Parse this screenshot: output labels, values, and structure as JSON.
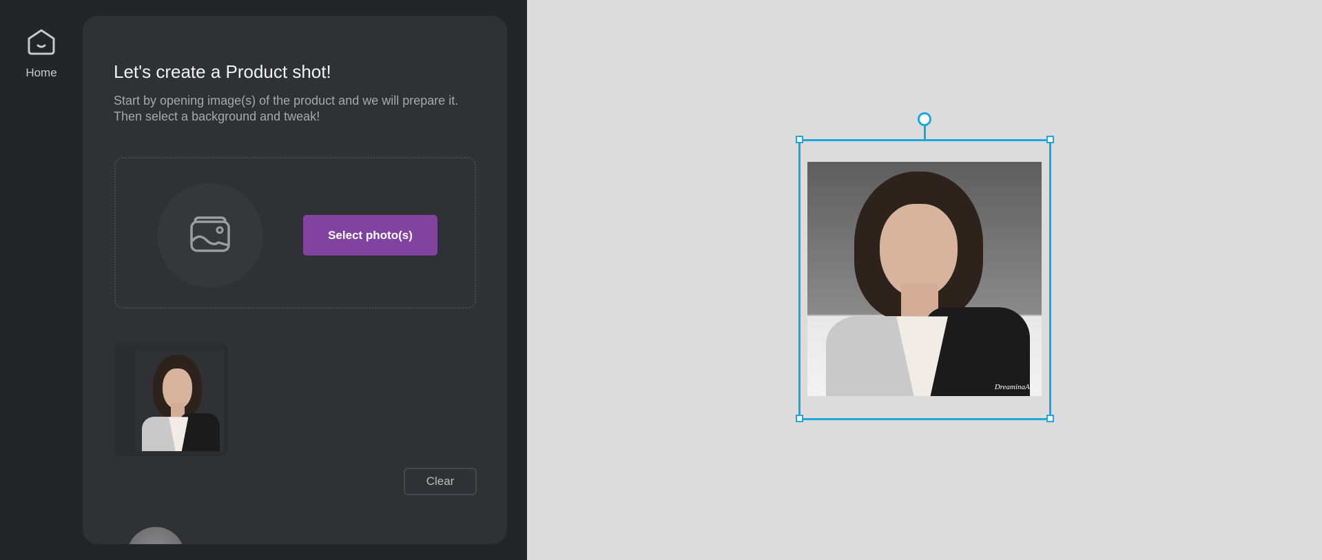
{
  "sidebar": {
    "home_label": "Home"
  },
  "panel": {
    "title": "Let's create a Product shot!",
    "subtitle": "Start by opening image(s) of the product and we will prepare it. Then select a background and tweak!",
    "select_button": "Select photo(s)",
    "clear_button": "Clear",
    "watermark": "DreaminaAI"
  },
  "colors": {
    "accent": "#8044a0",
    "selection": "#1ea5dd"
  }
}
